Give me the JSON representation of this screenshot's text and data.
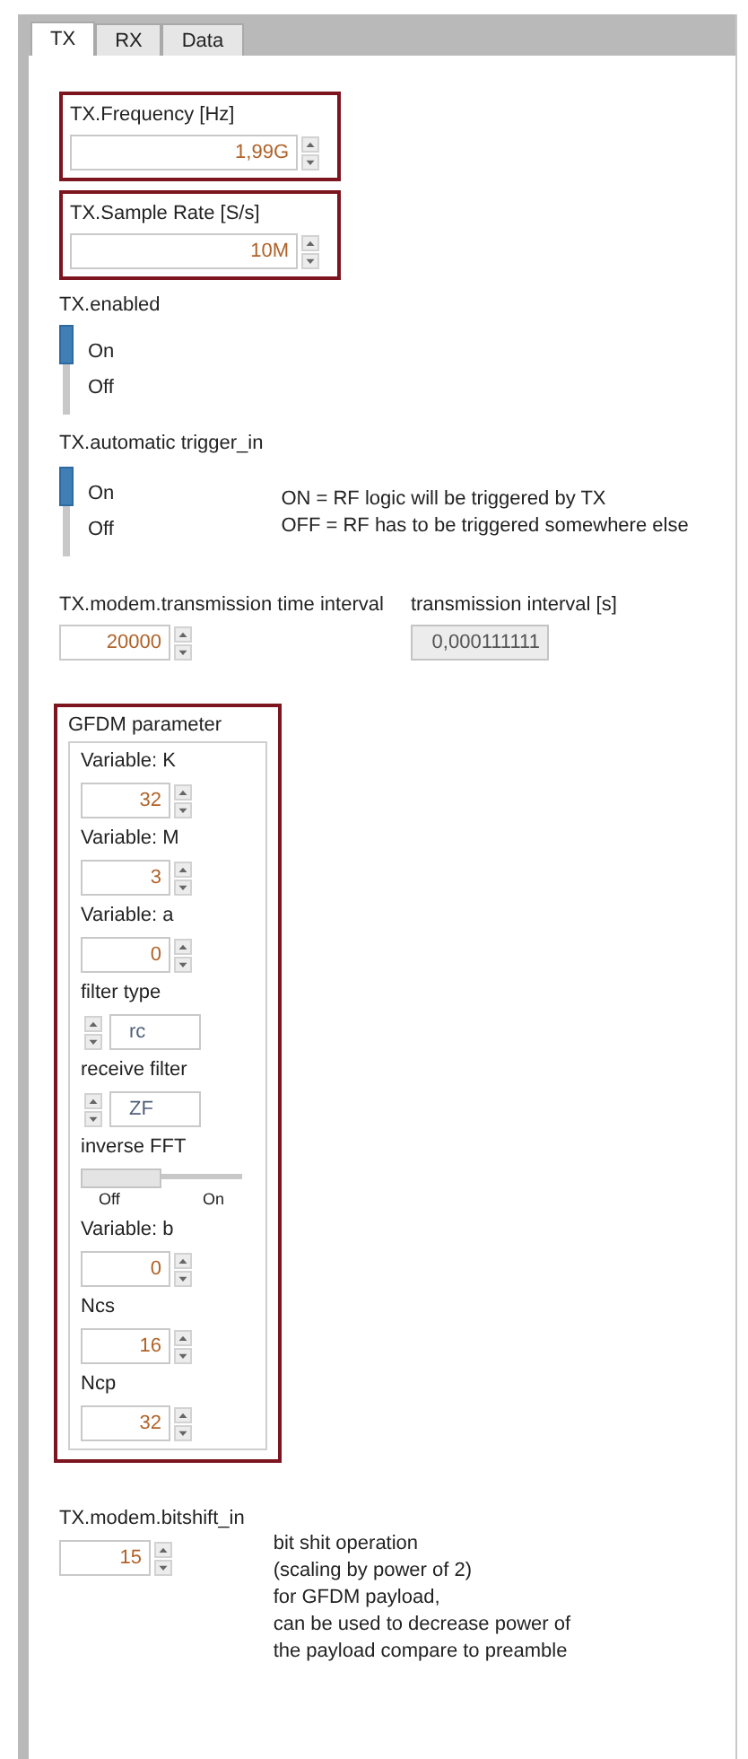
{
  "tabs": [
    {
      "label": "TX",
      "selected": true
    },
    {
      "label": "RX",
      "selected": false
    },
    {
      "label": "Data",
      "selected": false
    }
  ],
  "frequency": {
    "label": "TX.Frequency [Hz]",
    "value": "1,99G"
  },
  "sample_rate": {
    "label": "TX.Sample Rate [S/s]",
    "value": "10M"
  },
  "tx_enabled": {
    "label": "TX.enabled",
    "on_label": "On",
    "off_label": "Off",
    "on": true
  },
  "trigger": {
    "label": "TX.automatic trigger_in",
    "on_label": "On",
    "off_label": "Off",
    "on": true,
    "notes": [
      "ON = RF logic will be triggered by TX",
      "OFF = RF has to be triggered somewhere else"
    ]
  },
  "interval": {
    "label": "TX.modem.transmission time interval",
    "value": "20000"
  },
  "interval_indicator": {
    "label": "transmission interval [s]",
    "value": "0,000111111"
  },
  "gfdm": {
    "title": "GFDM parameter",
    "items": [
      {
        "kind": "numeric",
        "label": "Variable: K",
        "value": "32"
      },
      {
        "kind": "numeric",
        "label": "Variable: M",
        "value": "3"
      },
      {
        "kind": "numeric",
        "label": "Variable: a",
        "value": "0"
      },
      {
        "kind": "ring",
        "label": "filter type",
        "value": "rc"
      },
      {
        "kind": "ring",
        "label": "receive filter",
        "value": "ZF"
      },
      {
        "kind": "slider",
        "label": "inverse FFT",
        "off_label": "Off",
        "on_label": "On",
        "on": false
      },
      {
        "kind": "numeric",
        "label": "Variable: b",
        "value": "0"
      },
      {
        "kind": "numeric",
        "label": "Ncs",
        "value": "16"
      },
      {
        "kind": "numeric",
        "label": "Ncp",
        "value": "32"
      }
    ]
  },
  "bitshift": {
    "label": "TX.modem.bitshift_in",
    "value": "15",
    "notes": [
      "bit shit operation",
      "(scaling by power of 2)",
      "for GFDM payload,",
      "can be used to decrease power of",
      "the payload compare to preamble"
    ]
  }
}
